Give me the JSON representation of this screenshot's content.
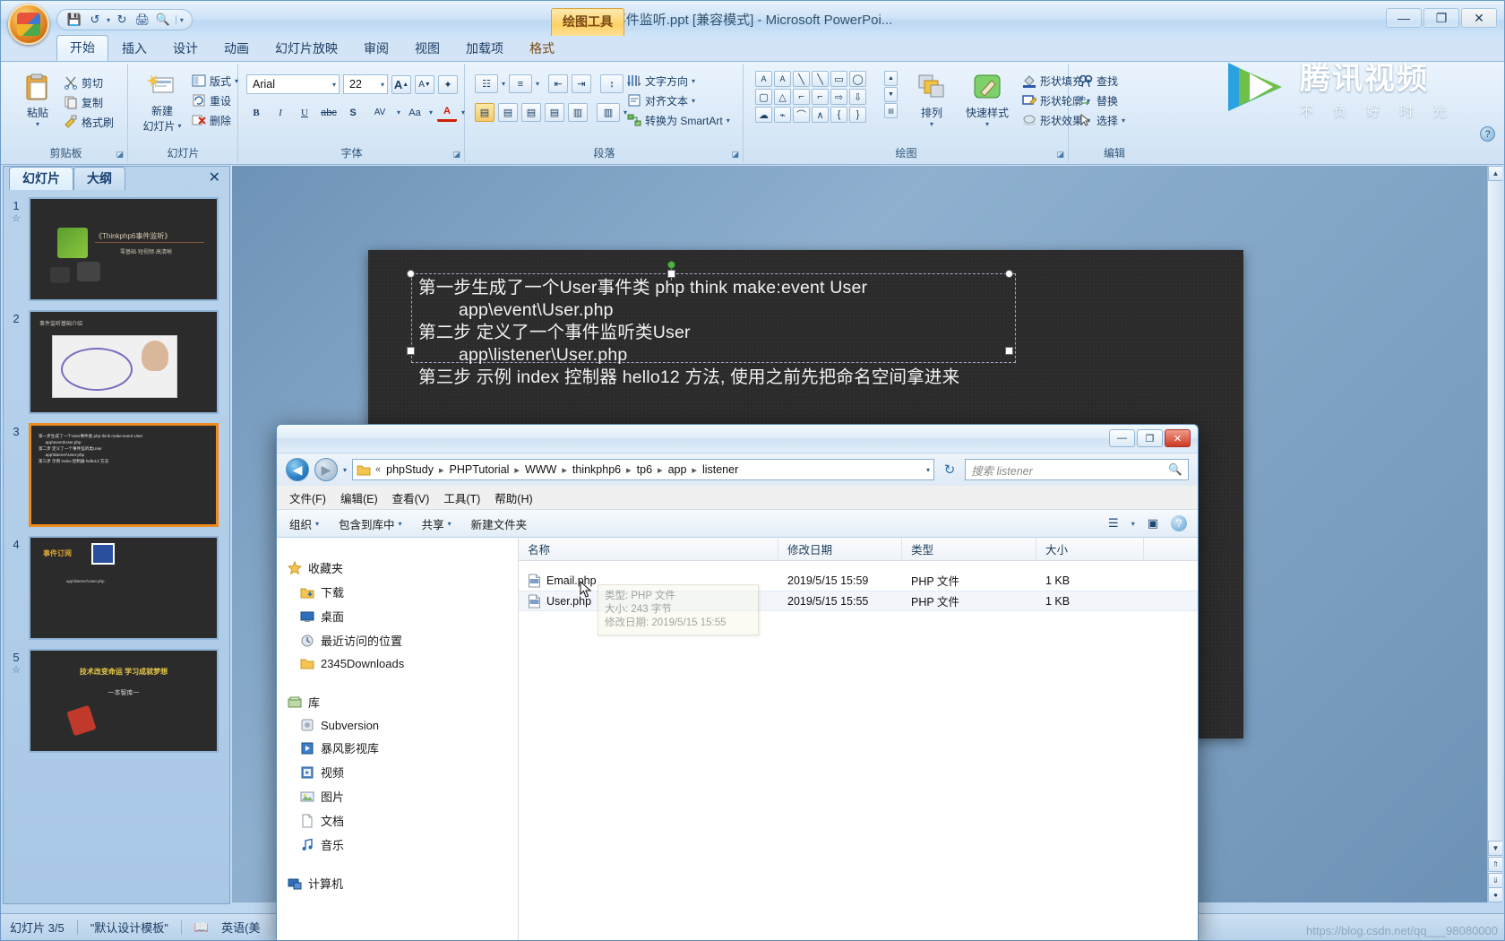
{
  "app": {
    "title": "事件监听.ppt [兼容模式] - Microsoft PowerPoi...",
    "context_tab": "绘图工具",
    "quick_access": [
      {
        "name": "save-icon",
        "glyph": "▤"
      },
      {
        "name": "undo-icon",
        "glyph": "↺"
      },
      {
        "name": "redo-icon",
        "glyph": "↻"
      },
      {
        "name": "print-icon",
        "glyph": "⎙"
      },
      {
        "name": "print-preview-icon",
        "glyph": "🔍"
      }
    ],
    "qat_more": "▾",
    "window_controls": {
      "minimize": "—",
      "maximize": "❐",
      "close": "✕"
    }
  },
  "ribbon": {
    "tabs": [
      {
        "label": "开始",
        "active": true
      },
      {
        "label": "插入",
        "active": false
      },
      {
        "label": "设计",
        "active": false
      },
      {
        "label": "动画",
        "active": false
      },
      {
        "label": "幻灯片放映",
        "active": false
      },
      {
        "label": "审阅",
        "active": false
      },
      {
        "label": "视图",
        "active": false
      },
      {
        "label": "加载项",
        "active": false
      },
      {
        "label": "格式",
        "active": false,
        "contextual": true
      }
    ],
    "groups": {
      "clipboard": {
        "label": "剪贴板",
        "paste": "粘贴",
        "items": [
          {
            "label": "剪切",
            "icon": "scissors-icon"
          },
          {
            "label": "复制",
            "icon": "copy-icon"
          },
          {
            "label": "格式刷",
            "icon": "format-painter-icon"
          }
        ]
      },
      "slides": {
        "label": "幻灯片",
        "new_slide_line1": "新建",
        "new_slide_line2": "幻灯片",
        "items": [
          {
            "label": "版式",
            "icon": "layout-icon",
            "caret": "▾"
          },
          {
            "label": "重设",
            "icon": "reset-icon",
            "caret": ""
          },
          {
            "label": "删除",
            "icon": "delete-icon",
            "caret": ""
          }
        ]
      },
      "font": {
        "label": "字体",
        "font_name": "Arial",
        "font_size": "22",
        "grow_font": "A",
        "shrink_font": "A",
        "clear_format": "✦",
        "bold": "B",
        "italic": "I",
        "underline": "U",
        "strikethrough": "abc",
        "shadow": "S",
        "char_spacing": "AV",
        "change_case": "Aa",
        "font_color": "A"
      },
      "paragraph": {
        "label": "段落",
        "bullets": "☰",
        "numbering": "☰",
        "decrease_indent": "⇤",
        "increase_indent": "⇥",
        "line_spacing": "↕",
        "align_left": "▤",
        "align_center": "▤",
        "align_right": "▤",
        "justify": "▤",
        "align_dist": "▥",
        "columns": "▥",
        "text_direction": "文字方向",
        "align_text": "对齐文本",
        "smartart": "转换为 SmartArt"
      },
      "drawing": {
        "label": "绘图",
        "arrange": "排列",
        "quick_styles": "快速样式",
        "shape_fill": "形状填充",
        "shape_outline": "形状轮廓",
        "shape_effects": "形状效果"
      },
      "editing": {
        "label": "编辑",
        "find": "查找",
        "replace": "替换",
        "select": "选择"
      }
    }
  },
  "slide_panel": {
    "tabs": [
      {
        "label": "幻灯片",
        "active": true
      },
      {
        "label": "大纲",
        "active": false
      }
    ],
    "close": "✕",
    "thumbnails": [
      {
        "number": "1",
        "starred": true,
        "selected": false,
        "preview_title": "《Thinkphp6事件监听》",
        "preview_sub": "零基础·短视频·高清晰"
      },
      {
        "number": "2",
        "starred": false,
        "selected": false,
        "preview_title": "事件监听基础介绍",
        "preview_sub": ""
      },
      {
        "number": "3",
        "starred": false,
        "selected": true,
        "preview_title": "第一步生成了一个User事件类",
        "preview_sub": "app\\event\\User.php"
      },
      {
        "number": "4",
        "starred": false,
        "selected": false,
        "preview_title": "事件订阅",
        "preview_sub": "app\\listener\\User.php"
      },
      {
        "number": "5",
        "starred": true,
        "selected": false,
        "preview_title": "技术改变命运  学习成就梦想",
        "preview_sub": "一本智库一"
      }
    ]
  },
  "slide": {
    "lines": [
      "第一步生成了一个User事件类 php think make:event User",
      "        app\\event\\User.php",
      "第二步 定义了一个事件监听类User",
      "        app\\listener\\User.php",
      "第三步 示例 index 控制器 hello12 方法, 使用之前先把命名空间拿进来"
    ]
  },
  "status_bar": {
    "slide_counter": "幻灯片 3/5",
    "template": "\"默认设计模板\"",
    "spellcheck_icon": "spellcheck-icon",
    "language": "英语(美"
  },
  "explorer": {
    "window_controls": {
      "minimize": "—",
      "maximize": "❐",
      "close": "✕"
    },
    "nav": {
      "back": "◀",
      "forward": "▶",
      "dropdown": "▾",
      "refresh": "↻"
    },
    "breadcrumb": {
      "prefix": "«",
      "parts": [
        "phpStudy",
        "PHPTutorial",
        "WWW",
        "thinkphp6",
        "tp6",
        "app",
        "listener"
      ],
      "separator": "▸",
      "caret": "▾"
    },
    "search": {
      "placeholder_prefix": "搜索 ",
      "placeholder": "搜索 listener",
      "scope": "listener",
      "icon": "search-icon"
    },
    "menus": [
      "文件(F)",
      "编辑(E)",
      "查看(V)",
      "工具(T)",
      "帮助(H)"
    ],
    "toolbar": [
      {
        "label": "组织",
        "caret": "▾"
      },
      {
        "label": "包含到库中",
        "caret": "▾"
      },
      {
        "label": "共享",
        "caret": "▾"
      },
      {
        "label": "新建文件夹",
        "caret": ""
      }
    ],
    "toolbar_right": {
      "view_icon": "view-list-icon",
      "view_caret": "▾",
      "preview_icon": "preview-pane-icon",
      "help_icon": "help-icon"
    },
    "navpane": [
      {
        "label": "收藏夹",
        "icon": "star-icon",
        "type": "group"
      },
      {
        "label": "下载",
        "icon": "downloads-icon",
        "type": "item"
      },
      {
        "label": "桌面",
        "icon": "desktop-icon",
        "type": "item"
      },
      {
        "label": "最近访问的位置",
        "icon": "recent-places-icon",
        "type": "item"
      },
      {
        "label": "2345Downloads",
        "icon": "folder-icon",
        "type": "item"
      },
      {
        "label": "库",
        "icon": "library-icon",
        "type": "group"
      },
      {
        "label": "Subversion",
        "icon": "subversion-icon",
        "type": "item"
      },
      {
        "label": "暴风影视库",
        "icon": "video-library-icon",
        "type": "item"
      },
      {
        "label": "视频",
        "icon": "video-icon",
        "type": "item"
      },
      {
        "label": "图片",
        "icon": "picture-icon",
        "type": "item"
      },
      {
        "label": "文档",
        "icon": "document-icon",
        "type": "item"
      },
      {
        "label": "音乐",
        "icon": "music-icon",
        "type": "item"
      },
      {
        "label": "计算机",
        "icon": "computer-icon",
        "type": "group"
      }
    ],
    "columns": [
      "名称",
      "修改日期",
      "类型",
      "大小"
    ],
    "files": [
      {
        "name": "Email.php",
        "modified": "2019/5/15 15:59",
        "type": "PHP 文件",
        "size": "1 KB",
        "icon": "php-file-icon",
        "selected": false
      },
      {
        "name": "User.php",
        "modified": "2019/5/15 15:55",
        "type": "PHP 文件",
        "size": "1 KB",
        "icon": "php-file-icon",
        "selected": true
      }
    ],
    "tooltip": {
      "line1": "类型: PHP 文件",
      "line2": "大小: 243 字节",
      "line3": "修改日期: 2019/5/15 15:55"
    }
  },
  "watermark": {
    "title": "腾讯视频",
    "subtitle": "不 负 好 时 光"
  },
  "footer_note": "https://blog.csdn.net/qq___98080000"
}
